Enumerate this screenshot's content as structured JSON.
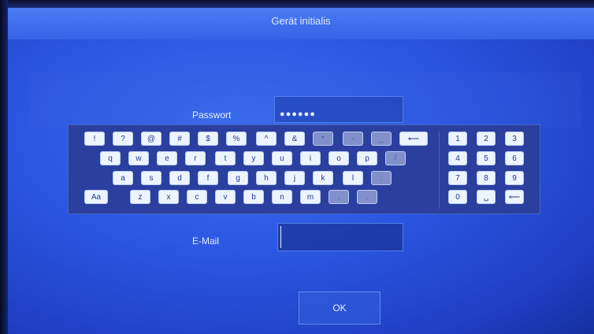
{
  "header": {
    "title": "Gerät initialis"
  },
  "form": {
    "password_label": "Passwort",
    "password_value": "●●●●●●",
    "email_label": "E-Mail",
    "email_value": ""
  },
  "keyboard": {
    "row1": [
      "!",
      "?",
      "@",
      "#",
      "$",
      "%",
      "^",
      "&",
      "*",
      "-",
      "_",
      "⟵"
    ],
    "row2": [
      "q",
      "w",
      "e",
      "r",
      "t",
      "y",
      "u",
      "i",
      "o",
      "p",
      "/"
    ],
    "row3": [
      "a",
      "s",
      "d",
      "f",
      "g",
      "h",
      "j",
      "k",
      "l",
      ":"
    ],
    "row4": [
      "Aa",
      "z",
      "x",
      "c",
      "v",
      "b",
      "n",
      "m",
      ",",
      "."
    ],
    "numpad": [
      "1",
      "2",
      "3",
      "4",
      "5",
      "6",
      "7",
      "8",
      "9",
      "0",
      "␣",
      "⟵"
    ]
  },
  "buttons": {
    "ok_label": "OK"
  }
}
